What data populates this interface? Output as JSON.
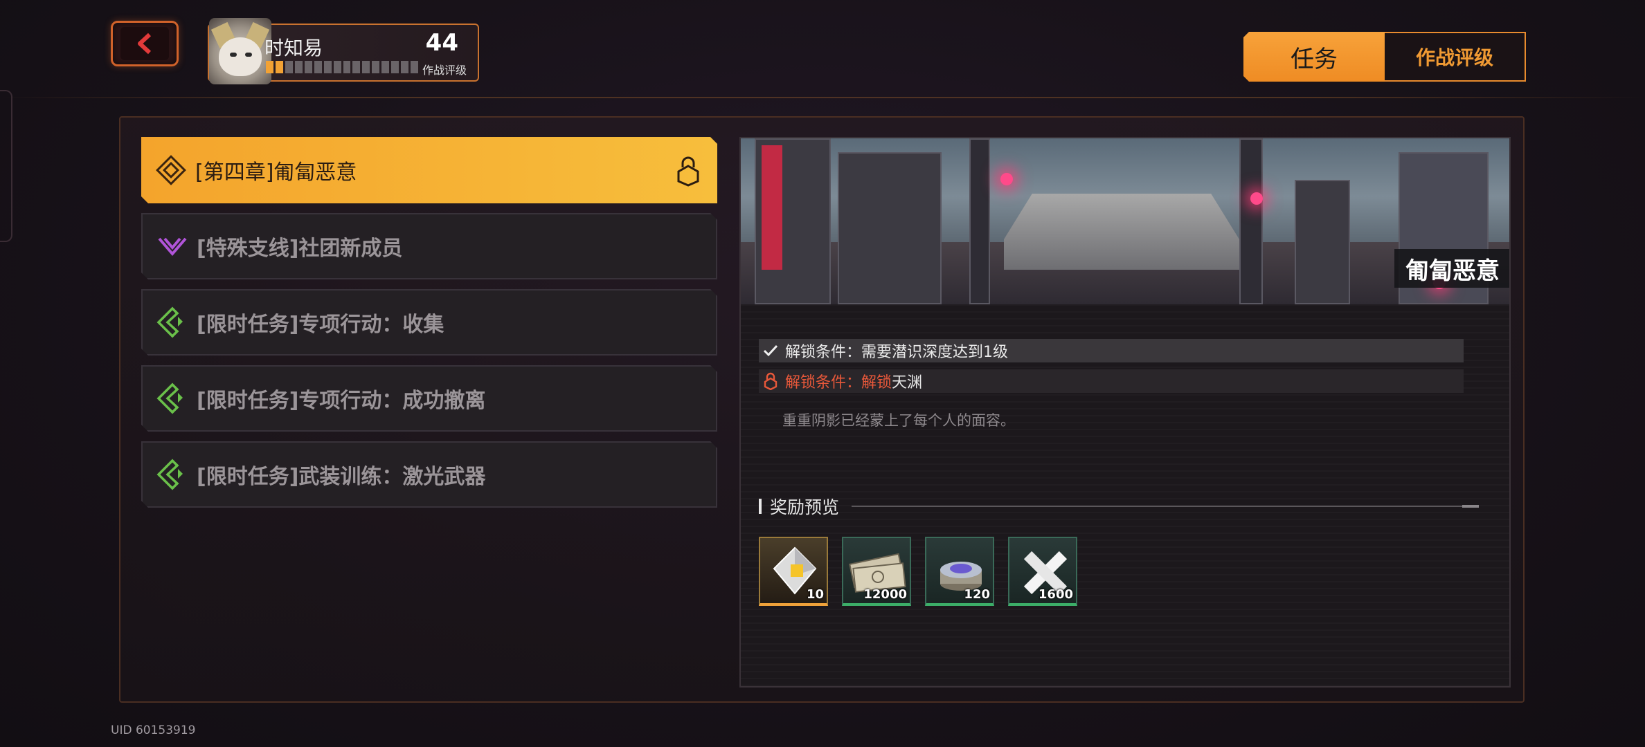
{
  "header": {
    "player_name": "时知易",
    "level": "44",
    "rank_label": "作战评级",
    "xp_progress": 0.12
  },
  "tabs": [
    {
      "label": "任务",
      "active": true
    },
    {
      "label": "作战评级",
      "active": false
    }
  ],
  "quests": [
    {
      "label": "[第四章]匍匐恶意",
      "active": true,
      "icon": "chapter-diamond-icon",
      "locked": true,
      "color": "#f4a42c"
    },
    {
      "label": "[特殊支线]社团新成员",
      "active": false,
      "icon": "side-quest-chevron-icon",
      "color": "#b054d8"
    },
    {
      "label": "[限时任务]专项行动：收集",
      "active": false,
      "icon": "limited-quest-icon",
      "color": "#6ac04a"
    },
    {
      "label": "[限时任务]专项行动：成功撤离",
      "active": false,
      "icon": "limited-quest-icon",
      "color": "#6ac04a"
    },
    {
      "label": "[限时任务]武装训练：激光武器",
      "active": false,
      "icon": "limited-quest-icon",
      "color": "#6ac04a"
    }
  ],
  "detail": {
    "banner_title": "匍匐恶意",
    "condition1": "解锁条件：需要潜识深度达到1级",
    "condition2_prefix": "解锁条件：",
    "condition2_link": "解锁",
    "condition2_target": "天渊",
    "description": "重重阴影已经蒙上了每个人的面容。",
    "rewards_title": "奖励预览",
    "rewards": [
      {
        "amount": "10",
        "icon": "crystal-cube-icon",
        "rarity": "gold"
      },
      {
        "amount": "12000",
        "icon": "banknotes-icon",
        "rarity": "green"
      },
      {
        "amount": "120",
        "icon": "data-chip-icon",
        "rarity": "green"
      },
      {
        "amount": "1600",
        "icon": "crossed-bandage-icon",
        "rarity": "green"
      }
    ]
  },
  "footer": {
    "uid": "UID 60153919"
  }
}
